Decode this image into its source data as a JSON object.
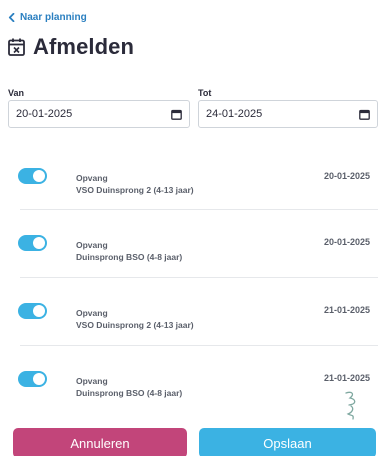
{
  "nav": {
    "back_label": "Naar planning"
  },
  "header": {
    "title": "Afmelden",
    "icon": "calendar-x-icon"
  },
  "filters": {
    "from_label": "Van",
    "from_value": "20-01-2025",
    "to_label": "Tot",
    "to_value": "24-01-2025"
  },
  "items": [
    {
      "enabled": true,
      "type": "Opvang",
      "location": "VSO Duinsprong 2 (4-13 jaar)",
      "date": "20-01-2025"
    },
    {
      "enabled": true,
      "type": "Opvang",
      "location": "Duinsprong BSO (4-8 jaar)",
      "date": "20-01-2025"
    },
    {
      "enabled": true,
      "type": "Opvang",
      "location": "VSO Duinsprong 2 (4-13 jaar)",
      "date": "21-01-2025"
    },
    {
      "enabled": true,
      "type": "Opvang",
      "location": "Duinsprong BSO (4-8 jaar)",
      "date": "21-01-2025"
    }
  ],
  "actions": {
    "cancel_label": "Annuleren",
    "save_label": "Opslaan"
  },
  "colors": {
    "accent": "#3bb2e3",
    "cancel": "#c2457a",
    "link": "#2a7fc0",
    "text": "#2b2b3a"
  }
}
